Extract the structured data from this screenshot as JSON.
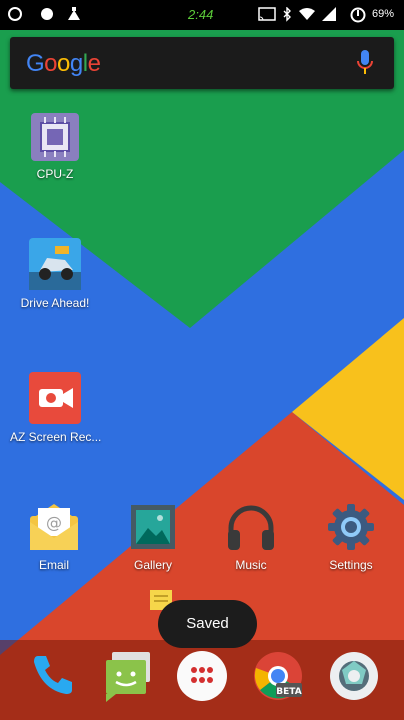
{
  "status_bar": {
    "time": "2:44",
    "battery": "69%",
    "icons": [
      "notification-icon",
      "record-icon",
      "cleaner-icon",
      "cast-icon",
      "bluetooth-icon",
      "wifi-icon",
      "signal-icon",
      "battery-icon"
    ]
  },
  "search_bar": {
    "logo": "Google",
    "icons": [
      "mic-icon"
    ]
  },
  "home_apps": [
    {
      "label": "CPU-Z",
      "icon": "cpu-z-icon"
    },
    {
      "label": "Drive Ahead!",
      "icon": "drive-ahead-icon"
    },
    {
      "label": "AZ Screen Rec...",
      "icon": "az-screen-recorder-icon"
    }
  ],
  "row_apps": [
    {
      "label": "Email",
      "icon": "email-icon"
    },
    {
      "label": "Gallery",
      "icon": "gallery-icon"
    },
    {
      "label": "Music",
      "icon": "headphones-icon"
    },
    {
      "label": "Settings",
      "icon": "settings-icon"
    }
  ],
  "toast": {
    "text": "Saved"
  },
  "dock": {
    "icons": [
      "phone-icon",
      "messaging-icon",
      "app-drawer-icon",
      "chrome-beta-icon",
      "camera-icon"
    ],
    "beta_label": "BETA"
  },
  "colors": {
    "wallpaper_blue": "#2f6fe0",
    "wallpaper_green": "#1a9e4e",
    "wallpaper_yellow": "#f8c11c",
    "wallpaper_red": "#d9462c",
    "status_time": "#5ccc3a"
  }
}
